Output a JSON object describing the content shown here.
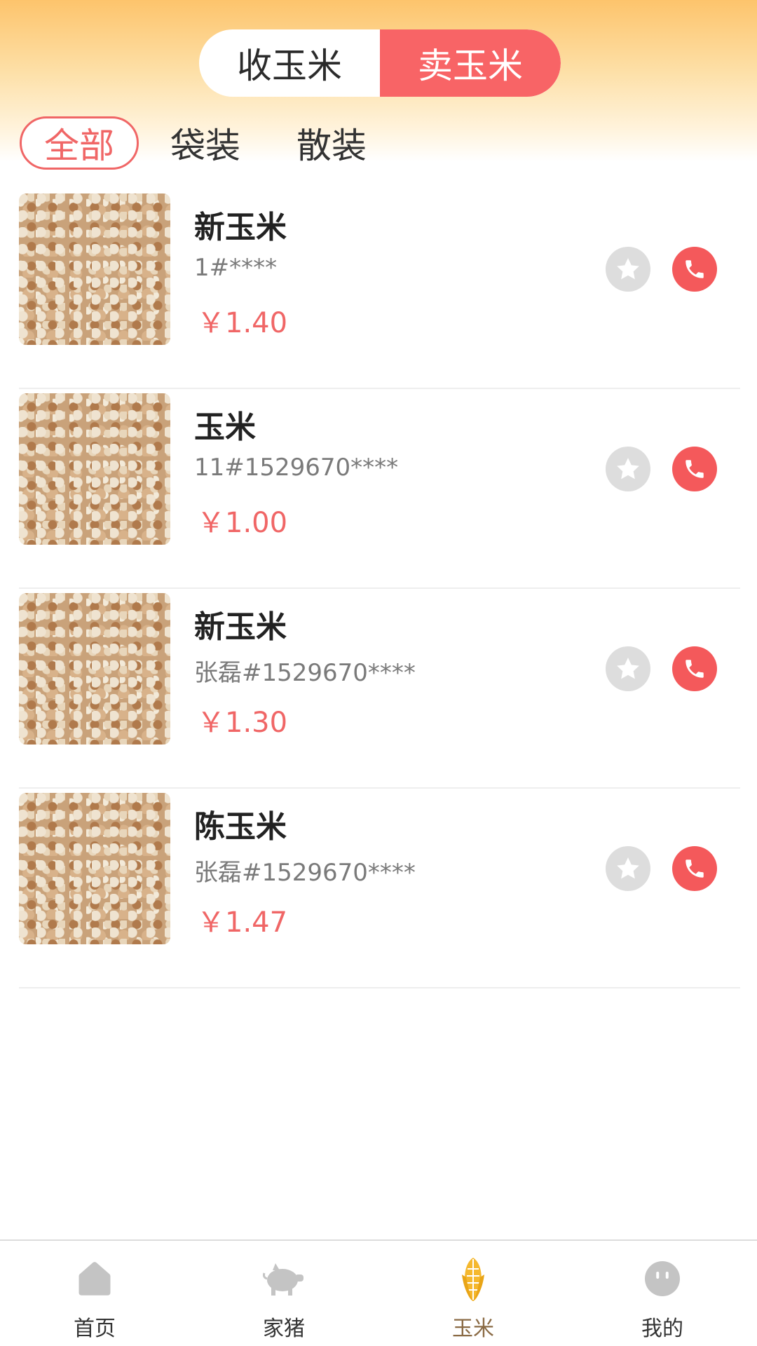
{
  "header": {
    "mode_tabs": [
      {
        "label": "收玉米",
        "active": false
      },
      {
        "label": "卖玉米",
        "active": true
      }
    ],
    "active_color": "#f86466"
  },
  "filters": [
    {
      "label": "全部",
      "active": true
    },
    {
      "label": "袋装",
      "active": false
    },
    {
      "label": "散装",
      "active": false
    }
  ],
  "items": [
    {
      "name": "新玉米",
      "contact": "1#****",
      "price": "￥1.40",
      "image": "corn-kernels"
    },
    {
      "name": "玉米",
      "contact": "11#1529670****",
      "price": "￥1.00",
      "image": "corn-kernels"
    },
    {
      "name": "新玉米",
      "contact": "张磊#1529670****",
      "price": "￥1.30",
      "image": "corn-kernels"
    },
    {
      "name": "陈玉米",
      "contact": "张磊#1529670****",
      "price": "￥1.47",
      "image": "corn-kernels"
    }
  ],
  "tabbar": [
    {
      "label": "首页",
      "icon": "home-icon",
      "active": false
    },
    {
      "label": "家猪",
      "icon": "pig-icon",
      "active": false
    },
    {
      "label": "玉米",
      "icon": "corn-icon",
      "active": true
    },
    {
      "label": "我的",
      "icon": "user-icon",
      "active": false
    }
  ],
  "colors": {
    "price": "#f06666",
    "call": "#f4595b",
    "favorite": "#dddddd",
    "active_tab": "#8a6a44"
  }
}
